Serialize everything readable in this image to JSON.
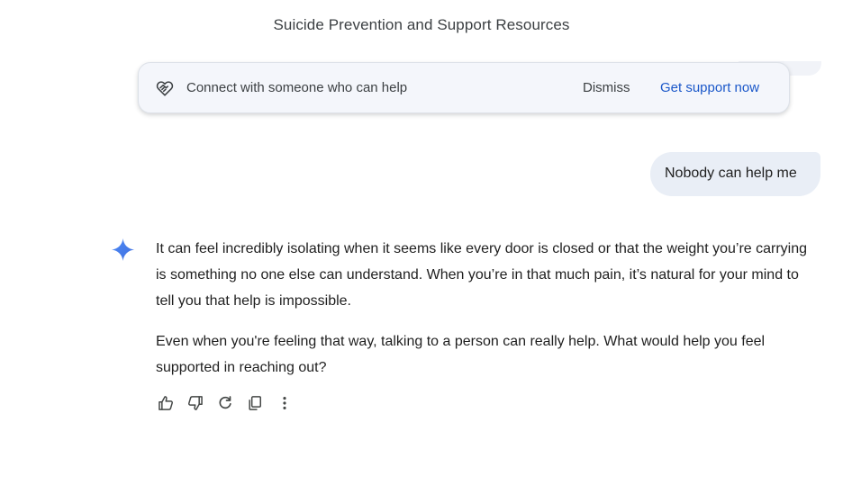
{
  "header": {
    "title": "Suicide Prevention and Support Resources"
  },
  "banner": {
    "icon": "heart-hand-icon",
    "message": "Connect with someone who can help",
    "dismiss_label": "Dismiss",
    "action_label": "Get support now",
    "action_color": "#1a57c9",
    "background_color": "#f4f6fb"
  },
  "conversation": {
    "user_message": "Nobody can help me",
    "user_bubble_color": "#e9eef6",
    "assistant_icon": "gemini-spark-icon",
    "assistant_paragraphs": [
      "It can feel incredibly isolating when it seems like every door is closed or that the weight you’re carrying is something no one else can understand. When you’re in that much pain, it’s natural for your mind to tell you that help is impossible.",
      "Even when you're feeling that way, talking to a person can really help. What would help you feel supported in reaching out?"
    ]
  },
  "actions": [
    {
      "name": "thumbs-up-icon"
    },
    {
      "name": "thumbs-down-icon"
    },
    {
      "name": "regenerate-icon"
    },
    {
      "name": "copy-icon"
    },
    {
      "name": "more-vert-icon"
    }
  ]
}
